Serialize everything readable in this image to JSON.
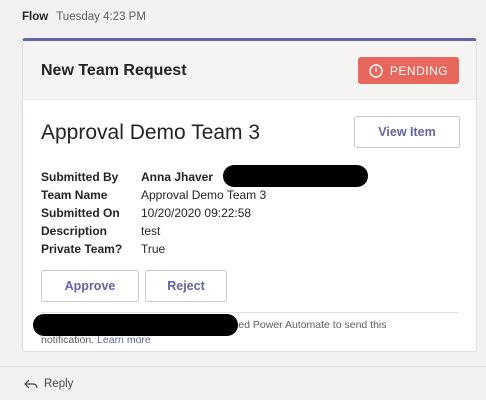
{
  "message": {
    "sender": "Flow",
    "time": "Tuesday 4:23 PM"
  },
  "card": {
    "title": "New Team Request",
    "status_label": "PENDING",
    "status_icon": "clock-icon",
    "team_title": "Approval Demo Team 3",
    "view_item_label": "View Item",
    "facts": [
      {
        "label": "Submitted By",
        "value": "Anna Jhaver"
      },
      {
        "label": "Team Name",
        "value": "Approval Demo Team 3"
      },
      {
        "label": "Submitted On",
        "value": "10/20/2020 09:22:58"
      },
      {
        "label": "Description",
        "value": "test"
      },
      {
        "label": "Private Team?",
        "value": "True"
      }
    ],
    "approve_label": "Approve",
    "reject_label": "Reject",
    "footer_text": "sed Power Automate to send this",
    "footer_text2": "notification.",
    "learn_more": "Learn more"
  },
  "reply": {
    "label": "Reply"
  },
  "colors": {
    "accent": "#6264a7",
    "pending": "#e7675c"
  }
}
